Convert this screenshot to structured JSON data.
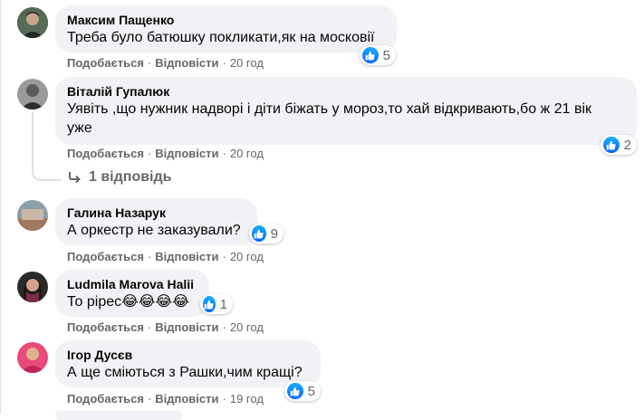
{
  "colors": {
    "bubble": "#f0f2f5",
    "secondary_text": "#65676b",
    "like_blue": "#0866ff"
  },
  "comments": [
    {
      "author": "Максим Пащенко",
      "text": "Треба було батюшку покликати,як на московії",
      "reaction_count": "5",
      "like": "Подобається",
      "reply": "Відповісти",
      "time": "20 год",
      "reaction_icon": "like-icon"
    },
    {
      "author": "Віталій Гупалюк",
      "text_line1": "Уявіть ,що нужник надворі і діти біжать у мороз,то хай відкривають,бо ж 21 вік",
      "text_line2": "уже",
      "reaction_count": "2",
      "like": "Подобається",
      "reply": "Відповісти",
      "time": "20 год",
      "replies_label": "1 відповідь",
      "reaction_icon": "like-icon"
    },
    {
      "author": "Галина Назарук",
      "text": "А оркестр не заказували?",
      "reaction_count": "9",
      "like": "Подобається",
      "reply": "Відповісти",
      "time": "20 год",
      "reaction_icon": "like-icon"
    },
    {
      "author": "Ludmila Marova Halii",
      "text": "То рірес😂😂😂😂",
      "reaction_count": "1",
      "like": "Подобається",
      "reply": "Відповісти",
      "time": "20 год",
      "reaction_icon": "like-icon"
    },
    {
      "author": "Ігор Дусєв",
      "text": "А ще сміються з Рашки,чим кращі?",
      "reaction_count": "5",
      "like": "Подобається",
      "reply": "Відповісти",
      "time": "19 год",
      "reaction_icon": "like-icon"
    }
  ]
}
